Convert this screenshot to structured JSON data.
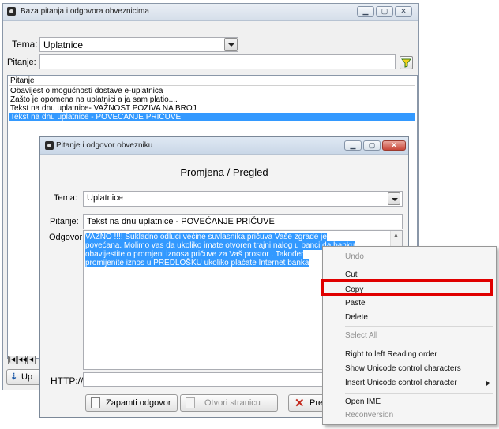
{
  "main_window": {
    "title": "Baza pitanja i odgovora obveznicima",
    "tema_label": "Tema:",
    "tema_value": "Uplatnice",
    "pitanje_label": "Pitanje:",
    "pitanje_value": "",
    "list_header": "Pitanje",
    "list_items": [
      {
        "text": "Obavijest o mogućnosti dostave e-uplatnica"
      },
      {
        "text": "Zašto je opomena na uplatnici a ja sam platio...."
      },
      {
        "text": "Tekst na dnu uplatnice- VAŽNOST POZIVA NA BROJ"
      },
      {
        "text": "Tekst na dnu uplatnice - POVEĆANJE PRIČUVE"
      }
    ],
    "add_button_label": "Up"
  },
  "dialog": {
    "title": "Pitanje i odgovor obvezniku",
    "heading": "Promjena / Pregled",
    "tema_label": "Tema:",
    "tema_value": "Uplatnice",
    "pitanje_label": "Pitanje:",
    "pitanje_value": "Tekst na dnu uplatnice - POVEĆANJE PRIČUVE",
    "odgovor_label": "Odgovor:",
    "odgovor_lines": [
      "VAŽNO !!!! Sukladno odluci većine suvlasnika  pričuva Vaše zgrade je",
      "povećana.  Molimo vas da ukoliko imate otvoren trajni nalog  u banci da banku",
      "obavijestite o promjeni iznosa pričuve za Vaš prostor . Također",
      "promijenite iznos u PREDLOŠKU ukoliko plaćate Internet banka"
    ],
    "http_label": "HTTP://",
    "save_button": "Zapamti odgovor",
    "open_page_button": "Otvori stranicu",
    "cancel_button": "Prek"
  },
  "context_menu": {
    "items": [
      {
        "label": "Undo",
        "disabled": true
      },
      {
        "label": "Cut",
        "disabled": false
      },
      {
        "label": "Copy",
        "disabled": false,
        "highlighted": true
      },
      {
        "label": "Paste",
        "disabled": false
      },
      {
        "label": "Delete",
        "disabled": false
      },
      {
        "label": "Select All",
        "disabled": true
      },
      {
        "label": "Right to left Reading order",
        "disabled": false
      },
      {
        "label": "Show Unicode control characters",
        "disabled": false
      },
      {
        "label": "Insert Unicode control character",
        "disabled": false,
        "submenu": true
      },
      {
        "label": "Open IME",
        "disabled": false
      },
      {
        "label": "Reconversion",
        "disabled": true
      }
    ],
    "highlight_color": "#e00000"
  }
}
